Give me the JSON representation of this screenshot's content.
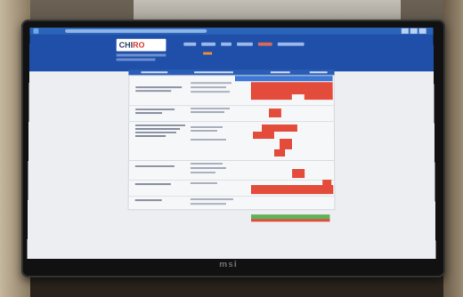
{
  "scene": {
    "monitor_brand": "msi",
    "app_logo": {
      "part1": "CHI",
      "part2": "RO"
    }
  },
  "colors": {
    "app_header": "#1f4fa8",
    "table_header": "#2a5db5",
    "highlight_cell": "#e34c3a",
    "success_bar": "#5fb25a"
  }
}
